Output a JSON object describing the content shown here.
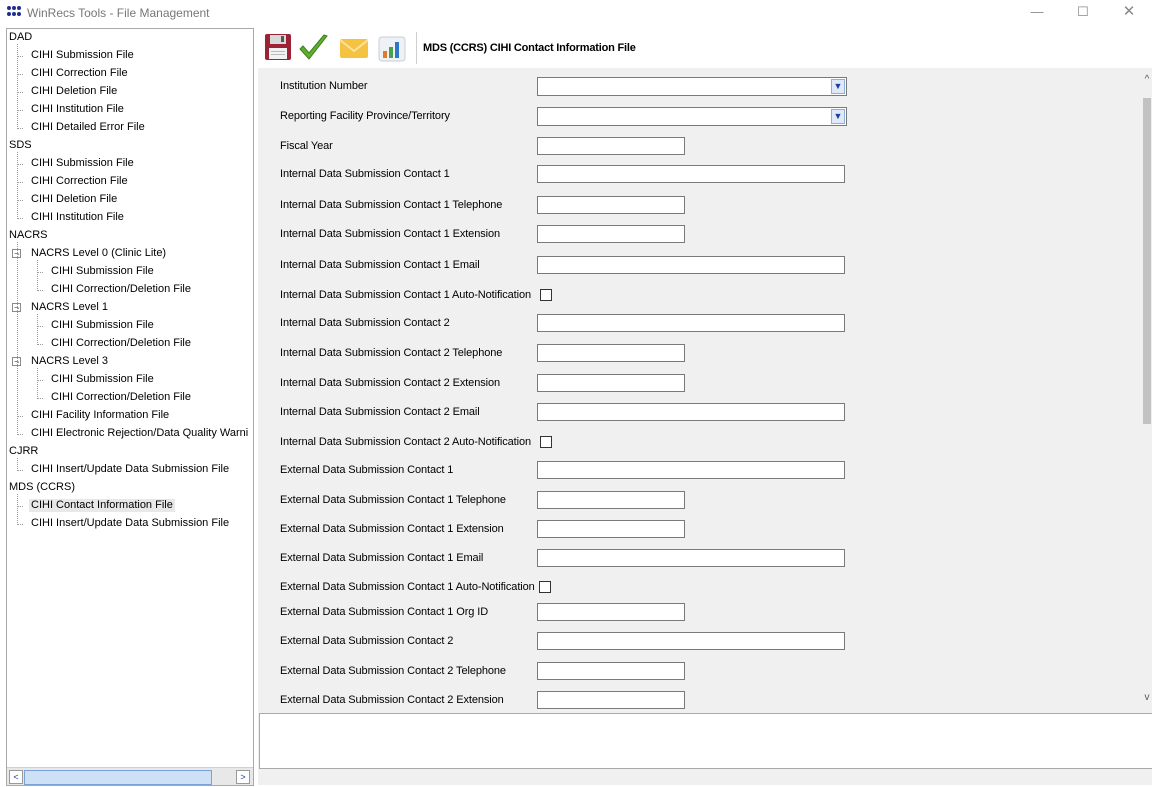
{
  "window": {
    "title": "WinRecs Tools - File Management",
    "minimize_glyph": "—",
    "maximize_glyph": "☐",
    "close_glyph": "✕"
  },
  "tree": {
    "nodes": [
      {
        "label": "DAD",
        "level": 0
      },
      {
        "label": "CIHI Submission File",
        "level": 1
      },
      {
        "label": "CIHI Correction File",
        "level": 1
      },
      {
        "label": "CIHI Deletion File",
        "level": 1
      },
      {
        "label": "CIHI Institution File",
        "level": 1
      },
      {
        "label": "CIHI Detailed Error File",
        "level": 1
      },
      {
        "label": "SDS",
        "level": 0
      },
      {
        "label": "CIHI Submission File",
        "level": 1
      },
      {
        "label": "CIHI Correction File",
        "level": 1
      },
      {
        "label": "CIHI Deletion File",
        "level": 1
      },
      {
        "label": "CIHI Institution File",
        "level": 1
      },
      {
        "label": "NACRS",
        "level": 0
      },
      {
        "label": "NACRS Level 0 (Clinic Lite)",
        "level": 1,
        "expanded": true
      },
      {
        "label": "CIHI Submission File",
        "level": 2
      },
      {
        "label": "CIHI Correction/Deletion File",
        "level": 2
      },
      {
        "label": "NACRS Level 1",
        "level": 1,
        "expanded": true
      },
      {
        "label": "CIHI Submission File",
        "level": 2
      },
      {
        "label": "CIHI Correction/Deletion File",
        "level": 2
      },
      {
        "label": "NACRS Level 3",
        "level": 1,
        "expanded": true
      },
      {
        "label": "CIHI Submission File",
        "level": 2
      },
      {
        "label": "CIHI Correction/Deletion File",
        "level": 2
      },
      {
        "label": "CIHI Facility Information File",
        "level": 1
      },
      {
        "label": "CIHI Electronic Rejection/Data Quality Warni",
        "level": 1
      },
      {
        "label": "CJRR",
        "level": 0
      },
      {
        "label": "CIHI Insert/Update Data Submission File",
        "level": 1
      },
      {
        "label": "MDS (CCRS)",
        "level": 0
      },
      {
        "label": "CIHI Contact Information File",
        "level": 1,
        "selected": true
      },
      {
        "label": "CIHI Insert/Update Data Submission File",
        "level": 1
      }
    ],
    "expand_glyph": "−"
  },
  "toolbar": {
    "save_icon": "floppy-disk",
    "validate_icon": "green-checkmark",
    "email_icon": "envelope",
    "report_icon": "bar-chart",
    "form_title": "MDS (CCRS) CIHI Contact Information File"
  },
  "form": {
    "fields": [
      {
        "label": "Institution Number",
        "type": "dropdown",
        "value": ""
      },
      {
        "label": "Reporting Facility Province/Territory",
        "type": "dropdown",
        "value": ""
      },
      {
        "label": "Fiscal Year",
        "type": "short",
        "value": ""
      },
      {
        "label": "Internal Data Submission Contact 1",
        "type": "long",
        "value": ""
      },
      {
        "label": "Internal Data Submission Contact 1 Telephone",
        "type": "short",
        "value": ""
      },
      {
        "label": "Internal Data Submission Contact 1 Extension",
        "type": "short",
        "value": ""
      },
      {
        "label": "Internal Data Submission Contact 1 Email",
        "type": "long",
        "value": ""
      },
      {
        "label": "Internal Data Submission Contact 1 Auto-Notification",
        "type": "checkbox",
        "checked": false
      },
      {
        "label": "Internal Data Submission Contact 2",
        "type": "long",
        "value": ""
      },
      {
        "label": "Internal Data Submission Contact 2 Telephone",
        "type": "short",
        "value": ""
      },
      {
        "label": "Internal Data Submission Contact 2 Extension",
        "type": "short",
        "value": ""
      },
      {
        "label": "Internal Data Submission Contact 2 Email",
        "type": "long",
        "value": ""
      },
      {
        "label": "Internal Data Submission Contact 2 Auto-Notification",
        "type": "checkbox",
        "checked": false
      },
      {
        "label": "External Data Submission Contact 1",
        "type": "long",
        "value": ""
      },
      {
        "label": "External Data Submission Contact 1 Telephone",
        "type": "short",
        "value": ""
      },
      {
        "label": "External Data Submission Contact 1 Extension",
        "type": "short",
        "value": ""
      },
      {
        "label": "External Data Submission Contact 1 Email",
        "type": "long",
        "value": ""
      },
      {
        "label": "External Data Submission Contact 1 Auto-Notification",
        "type": "checkbox",
        "checked": false
      },
      {
        "label": "External Data Submission Contact 1 Org ID",
        "type": "short",
        "value": ""
      },
      {
        "label": "External Data Submission Contact 2",
        "type": "long",
        "value": ""
      },
      {
        "label": "External Data Submission Contact 2 Telephone",
        "type": "short",
        "value": ""
      },
      {
        "label": "External Data Submission Contact 2 Extension",
        "type": "short",
        "value": ""
      }
    ],
    "dropdown_glyph": "▼"
  },
  "scroll": {
    "up_glyph": "^",
    "down_glyph": "v",
    "left_glyph": "<",
    "right_glyph": ">"
  },
  "colors": {
    "accent_blue": "#1a3fa0",
    "panel_bg": "#f0f0f0",
    "selection_bg": "#e8e8e8"
  }
}
